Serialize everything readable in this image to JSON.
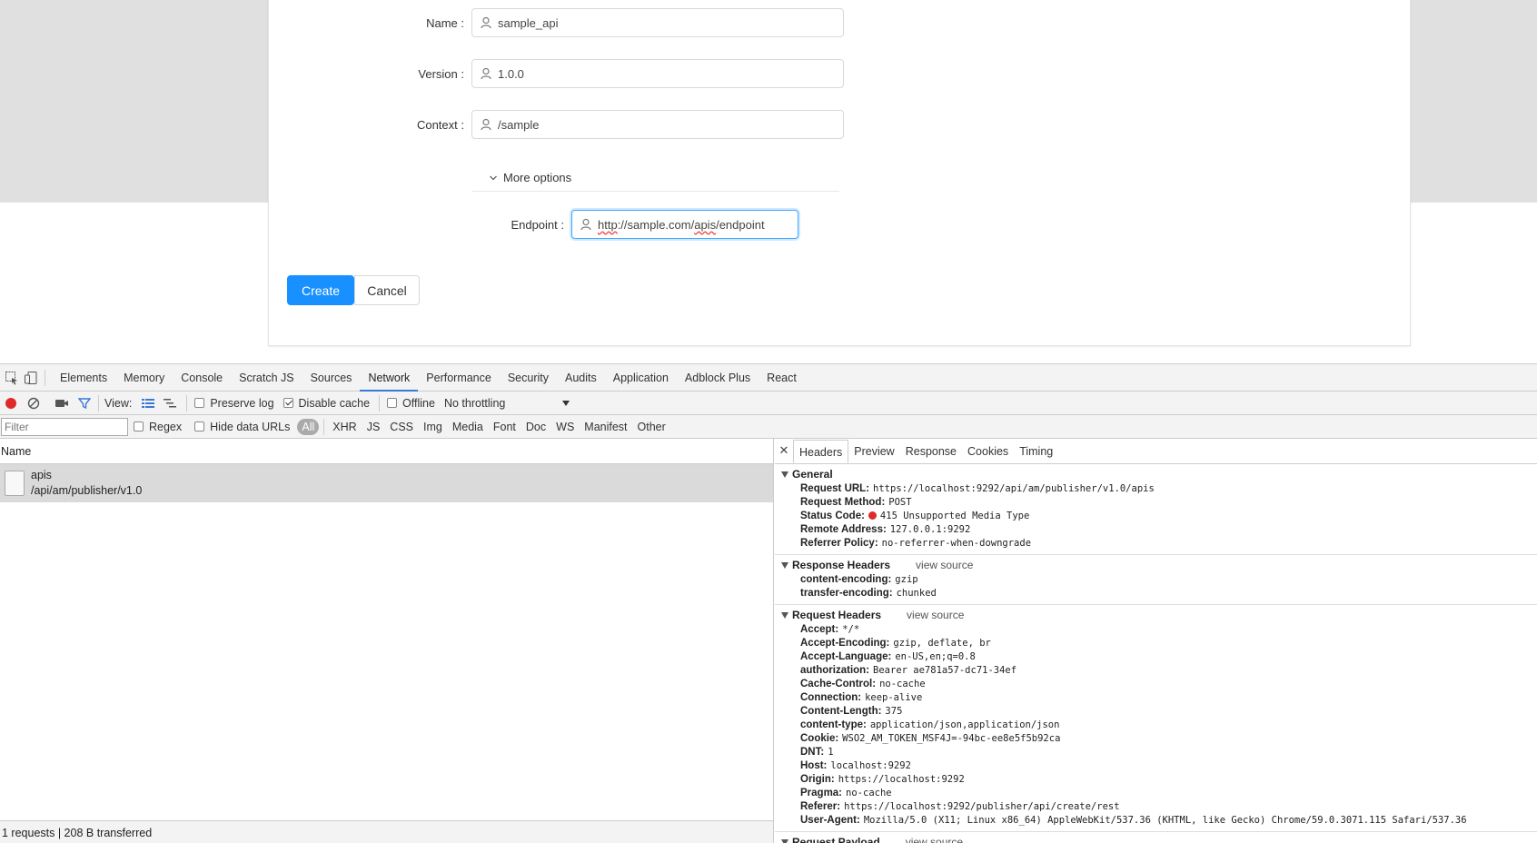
{
  "form": {
    "name_label": "Name",
    "name_value": "sample_api",
    "version_label": "Version",
    "version_value": "1.0.0",
    "context_label": "Context",
    "context_value": "/sample",
    "more_options": "More options",
    "endpoint_label": "Endpoint",
    "endpoint_prefix": "http",
    "endpoint_mid1": "://sample.com/",
    "endpoint_apis": "apis",
    "endpoint_suffix": "/endpoint",
    "create_label": "Create",
    "cancel_label": "Cancel",
    "primary_color": "#1890ff"
  },
  "devtools": {
    "tabs": [
      "Elements",
      "Memory",
      "Console",
      "Scratch JS",
      "Sources",
      "Network",
      "Performance",
      "Security",
      "Audits",
      "Application",
      "Adblock Plus",
      "React"
    ],
    "active_tab": "Network",
    "toolbar": {
      "view_label": "View:",
      "preserve_log": "Preserve log",
      "disable_cache": "Disable cache",
      "offline": "Offline",
      "throttling": "No throttling"
    },
    "filterbar": {
      "filter_placeholder": "Filter",
      "regex": "Regex",
      "hide_data_urls": "Hide data URLs",
      "types": [
        "All",
        "XHR",
        "JS",
        "CSS",
        "Img",
        "Media",
        "Font",
        "Doc",
        "WS",
        "Manifest",
        "Other"
      ]
    },
    "list": {
      "column_name": "Name",
      "rows": [
        {
          "name": "apis",
          "path": "/api/am/publisher/v1.0"
        }
      ],
      "status": "1 requests  |  208 B transferred"
    },
    "detail": {
      "tabs": [
        "Headers",
        "Preview",
        "Response",
        "Cookies",
        "Timing"
      ],
      "general": {
        "title": "General",
        "request_url_k": "Request URL:",
        "request_url_v": "https://localhost:9292/api/am/publisher/v1.0/apis",
        "method_k": "Request Method:",
        "method_v": "POST",
        "status_k": "Status Code:",
        "status_v": "415 Unsupported Media Type",
        "remote_k": "Remote Address:",
        "remote_v": "127.0.0.1:9292",
        "referrer_k": "Referrer Policy:",
        "referrer_v": "no-referrer-when-downgrade"
      },
      "response_headers": {
        "title": "Response Headers",
        "view_source": "view source",
        "items": [
          {
            "k": "content-encoding:",
            "v": "gzip"
          },
          {
            "k": "transfer-encoding:",
            "v": "chunked"
          }
        ]
      },
      "request_headers": {
        "title": "Request Headers",
        "view_source": "view source",
        "items": [
          {
            "k": "Accept:",
            "v": "*/*"
          },
          {
            "k": "Accept-Encoding:",
            "v": "gzip, deflate, br"
          },
          {
            "k": "Accept-Language:",
            "v": "en-US,en;q=0.8"
          },
          {
            "k": "authorization:",
            "v": "Bearer ae781a57-dc71-34ef"
          },
          {
            "k": "Cache-Control:",
            "v": "no-cache"
          },
          {
            "k": "Connection:",
            "v": "keep-alive"
          },
          {
            "k": "Content-Length:",
            "v": "375"
          },
          {
            "k": "content-type:",
            "v": "application/json,application/json"
          },
          {
            "k": "Cookie:",
            "v": "WSO2_AM_TOKEN_MSF4J=-94bc-ee8e5f5b92ca"
          },
          {
            "k": "DNT:",
            "v": "1"
          },
          {
            "k": "Host:",
            "v": "localhost:9292"
          },
          {
            "k": "Origin:",
            "v": "https://localhost:9292"
          },
          {
            "k": "Pragma:",
            "v": "no-cache"
          },
          {
            "k": "Referer:",
            "v": "https://localhost:9292/publisher/api/create/rest"
          },
          {
            "k": "User-Agent:",
            "v": "Mozilla/5.0 (X11; Linux x86_64) AppleWebKit/537.36 (KHTML, like Gecko) Chrome/59.0.3071.115 Safari/537.36"
          }
        ]
      },
      "request_payload": {
        "title": "Request Payload",
        "view_source": "view source"
      }
    }
  }
}
